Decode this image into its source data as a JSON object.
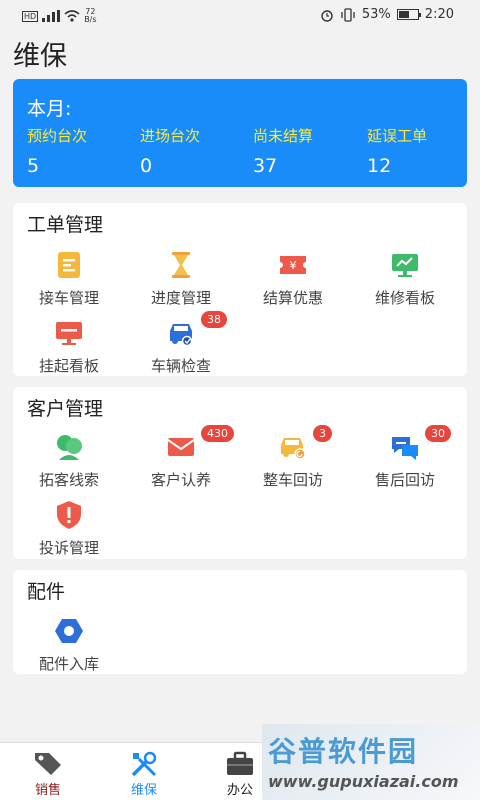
{
  "status_bar": {
    "hd": "HD",
    "net_top": "72",
    "net_bottom": "B/s",
    "battery": "53%",
    "time": "2:20",
    "battery_level": 0.53
  },
  "page_title": "维保",
  "month": {
    "label": "本月:",
    "stats": [
      {
        "label": "预约台次",
        "value": "5"
      },
      {
        "label": "进场台次",
        "value": "0"
      },
      {
        "label": "尚未结算",
        "value": "37"
      },
      {
        "label": "延误工单",
        "value": "12"
      }
    ]
  },
  "work_orders": {
    "title": "工单管理",
    "items": [
      {
        "label": "接车管理",
        "icon": "clipboard-icon"
      },
      {
        "label": "进度管理",
        "icon": "hourglass-icon"
      },
      {
        "label": "结算优惠",
        "icon": "coupon-icon"
      },
      {
        "label": "维修看板",
        "icon": "monitor-chart-icon"
      },
      {
        "label": "挂起看板",
        "icon": "monitor-icon"
      },
      {
        "label": "车辆检查",
        "icon": "car-check-icon",
        "badge": "38"
      }
    ]
  },
  "customers": {
    "title": "客户管理",
    "items": [
      {
        "label": "拓客线索",
        "icon": "users-icon"
      },
      {
        "label": "客户认养",
        "icon": "envelope-icon",
        "badge": "430"
      },
      {
        "label": "整车回访",
        "icon": "car-return-icon",
        "badge": "3"
      },
      {
        "label": "售后回访",
        "icon": "chat-icon",
        "badge": "30"
      },
      {
        "label": "投诉管理",
        "icon": "shield-alert-icon"
      }
    ]
  },
  "parts": {
    "title": "配件",
    "items": [
      {
        "label": "配件入库",
        "icon": "hex-nut-icon"
      }
    ]
  },
  "tabbar": {
    "items": [
      {
        "label": "销售",
        "icon": "tag-icon"
      },
      {
        "label": "维保",
        "icon": "tools-icon",
        "active": true
      },
      {
        "label": "办公",
        "icon": "briefcase-icon"
      }
    ]
  },
  "watermark": {
    "title": "谷普软件园",
    "url": "www.gupuxiazai.com"
  },
  "colors": {
    "primary": "#1a8cf9",
    "stat_label": "#ffe93b",
    "badge": "#e8453c",
    "tab_active": "#1a8cf9",
    "tab_inactive": "#8b1c1c"
  }
}
